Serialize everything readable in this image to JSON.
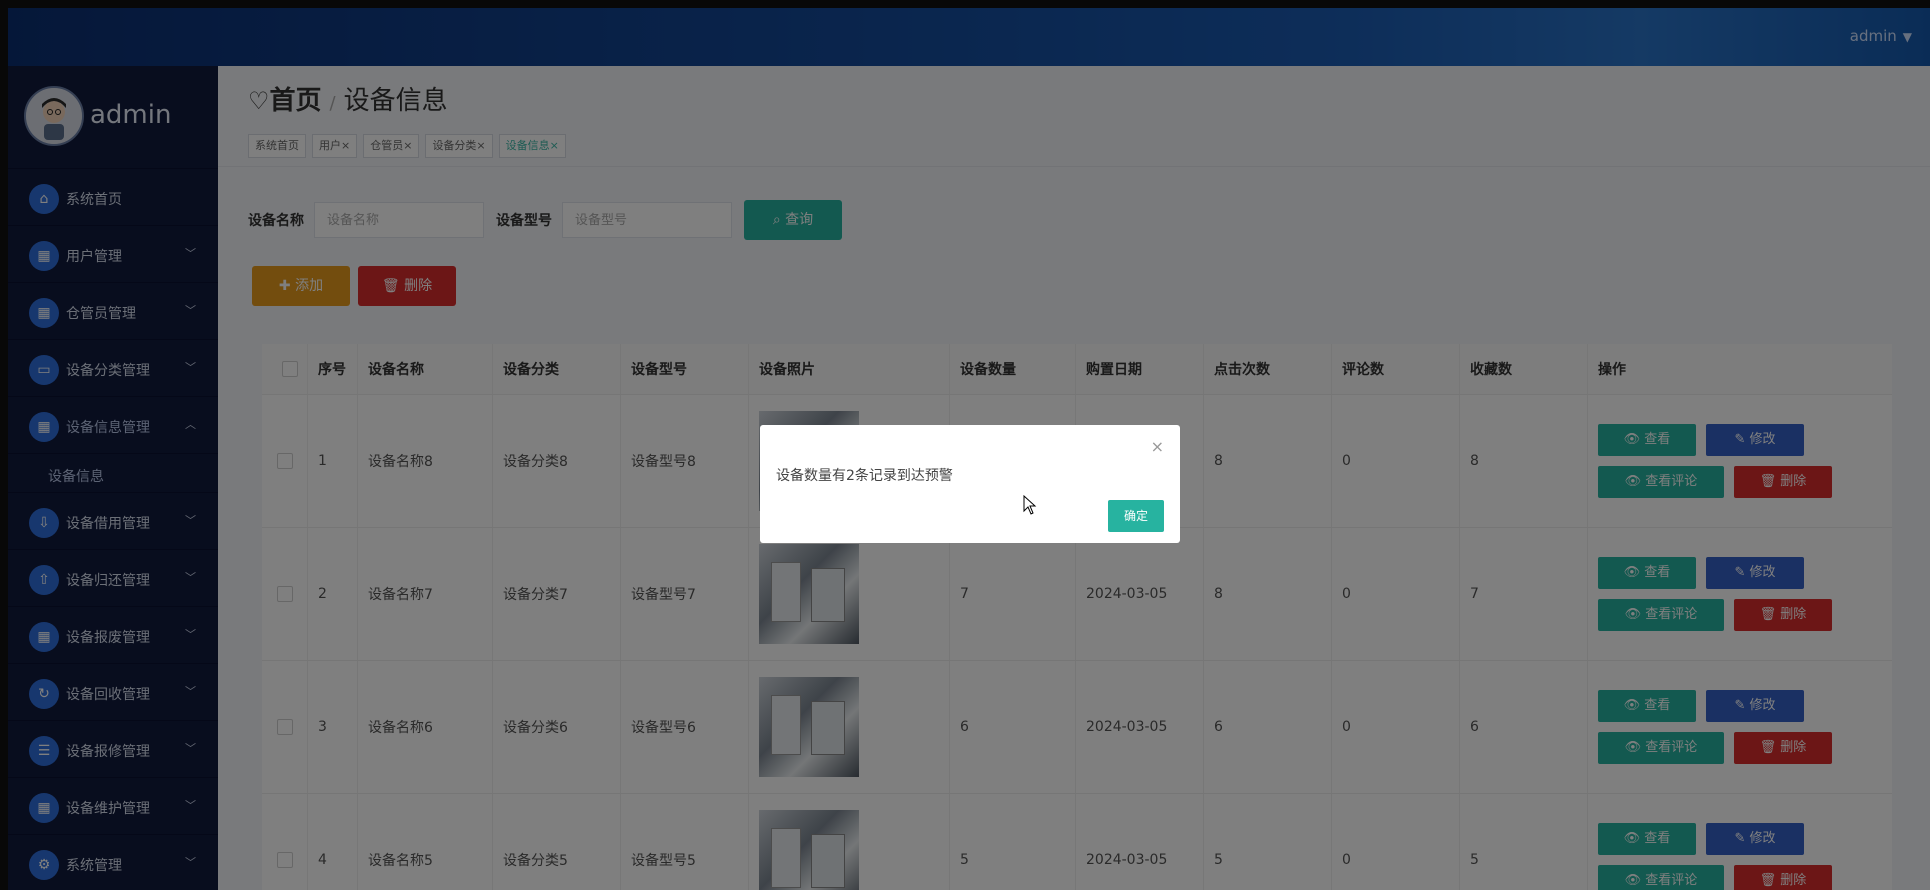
{
  "header": {
    "user_label": "admin",
    "caret": "▼"
  },
  "sidebar": {
    "brand_name": "admin",
    "items": [
      {
        "label": "系统首页",
        "icon": "home-icon",
        "chev": ""
      },
      {
        "label": "用户管理",
        "icon": "grid-icon",
        "chev": "﹀"
      },
      {
        "label": "仓管员管理",
        "icon": "grid-icon",
        "chev": "﹀"
      },
      {
        "label": "设备分类管理",
        "icon": "monitor-icon",
        "chev": "﹀"
      },
      {
        "label": "设备信息管理",
        "icon": "apps-icon",
        "chev": "︿"
      },
      {
        "label": "设备信息",
        "icon": "",
        "chev": ""
      },
      {
        "label": "设备借用管理",
        "icon": "borrow-icon",
        "chev": "﹀"
      },
      {
        "label": "设备归还管理",
        "icon": "return-icon",
        "chev": "﹀"
      },
      {
        "label": "设备报废管理",
        "icon": "grid-icon",
        "chev": "﹀"
      },
      {
        "label": "设备回收管理",
        "icon": "recycle-icon",
        "chev": "﹀"
      },
      {
        "label": "设备报修管理",
        "icon": "list-icon",
        "chev": "﹀"
      },
      {
        "label": "设备维护管理",
        "icon": "grid-icon",
        "chev": "﹀"
      },
      {
        "label": "系统管理",
        "icon": "settings-icon",
        "chev": "﹀"
      }
    ]
  },
  "breadcrumb": {
    "heart": "♡",
    "home": "首页",
    "sep": "/",
    "current": "设备信息"
  },
  "tags": [
    "系统首页",
    "用户×",
    "仓管员×",
    "设备分类×",
    "设备信息×"
  ],
  "search": {
    "name_label": "设备名称",
    "name_placeholder": "设备名称",
    "model_label": "设备型号",
    "model_placeholder": "设备型号",
    "button": "⌕ 查询"
  },
  "actions": {
    "add": "✚ 添加",
    "delete": "🗑 删除"
  },
  "table": {
    "headers": [
      "",
      "序号",
      "设备名称",
      "设备分类",
      "设备型号",
      "设备照片",
      "设备数量",
      "购置日期",
      "点击次数",
      "评论数",
      "收藏数",
      "操作"
    ],
    "rows": [
      {
        "no": "1",
        "name": "设备名称8",
        "category": "设备分类8",
        "model": "设备型号8",
        "qty": "",
        "date": "",
        "clicks": "8",
        "comments": "0",
        "favs": "8"
      },
      {
        "no": "2",
        "name": "设备名称7",
        "category": "设备分类7",
        "model": "设备型号7",
        "qty": "7",
        "date": "2024-03-05",
        "clicks": "8",
        "comments": "0",
        "favs": "7"
      },
      {
        "no": "3",
        "name": "设备名称6",
        "category": "设备分类6",
        "model": "设备型号6",
        "qty": "6",
        "date": "2024-03-05",
        "clicks": "6",
        "comments": "0",
        "favs": "6"
      },
      {
        "no": "4",
        "name": "设备名称5",
        "category": "设备分类5",
        "model": "设备型号5",
        "qty": "5",
        "date": "2024-03-05",
        "clicks": "5",
        "comments": "0",
        "favs": "5"
      }
    ],
    "ops": {
      "view": "👁 查看",
      "edit": "✎ 修改",
      "comments": "👁 查看评论",
      "remove": "🗑 删除"
    }
  },
  "dialog": {
    "message": "设备数量有2条记录到达预警",
    "ok": "确定",
    "close": "×"
  }
}
